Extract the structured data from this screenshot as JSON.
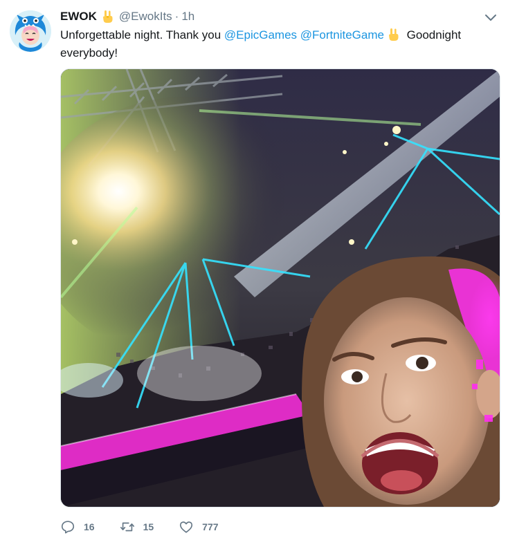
{
  "tweet": {
    "display_name": "EWOK",
    "handle": "@EwokIts",
    "separator": "·",
    "time": "1h",
    "text_part1": "Unforgettable night. Thank you ",
    "mention1": "@EpicGames",
    "mention2": "@FortniteGame",
    "text_part2": " Goodnight everybody!",
    "media_alt": "Selfie at arena with stage lasers"
  },
  "actions": {
    "reply_count": "16",
    "retweet_count": "15",
    "like_count": "777"
  },
  "colors": {
    "link": "#1b95e0",
    "muted": "#657786",
    "text": "#14171a"
  },
  "icons": {
    "avatar": "monster-hood-avatar",
    "emoji": "sign-of-the-horns-emoji",
    "caret": "chevron-down-icon",
    "reply": "reply-icon",
    "retweet": "retweet-icon",
    "like": "heart-icon"
  }
}
